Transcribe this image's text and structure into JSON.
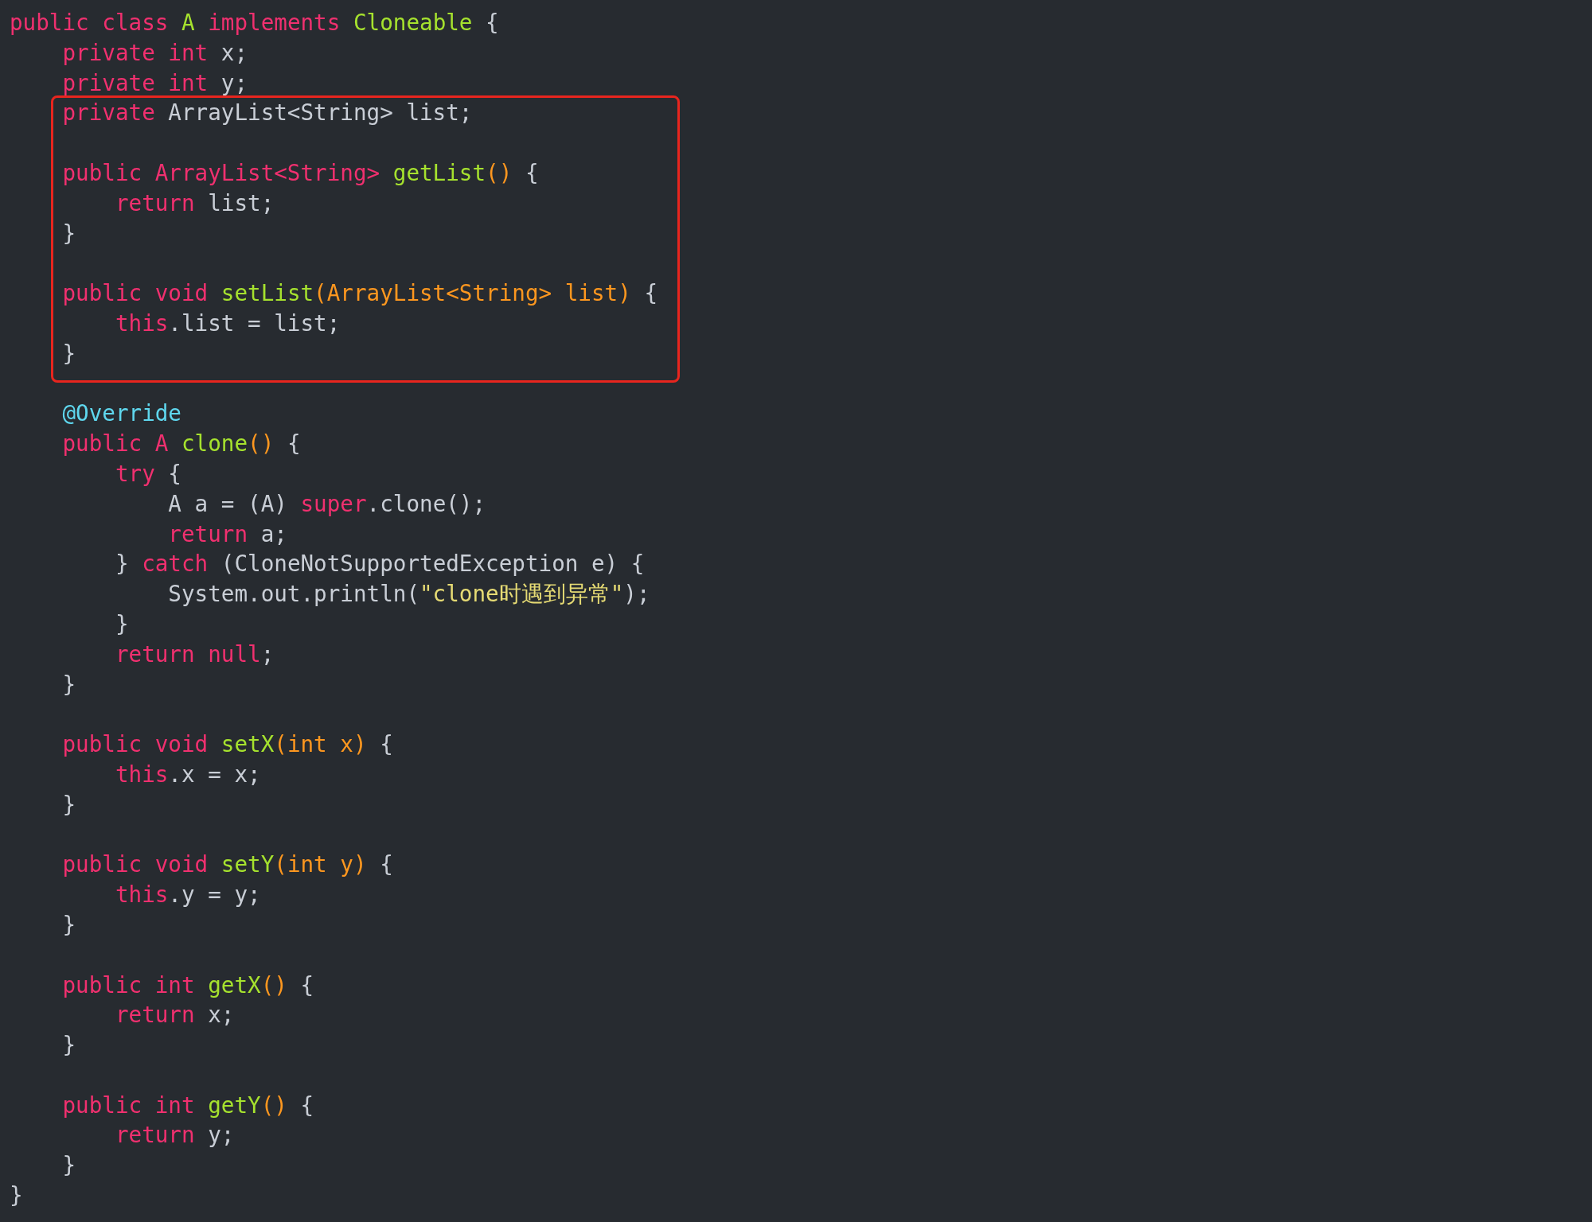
{
  "editor": {
    "segments": [
      {
        "highlighted": false,
        "lines": [
          {
            "kind": "code",
            "tokens": [
              {
                "text": "public class ",
                "kind": "kw"
              },
              {
                "text": "A",
                "kind": "fn"
              },
              {
                "text": " implements ",
                "kind": "kw"
              },
              {
                "text": "Cloneable",
                "kind": "fn"
              },
              {
                "text": " {",
                "kind": "pl"
              }
            ]
          },
          {
            "kind": "code",
            "tokens": [
              {
                "text": "    private int ",
                "kind": "kw"
              },
              {
                "text": "x;",
                "kind": "pl"
              }
            ]
          },
          {
            "kind": "code",
            "tokens": [
              {
                "text": "    private int ",
                "kind": "kw"
              },
              {
                "text": "y;",
                "kind": "pl"
              }
            ]
          }
        ]
      },
      {
        "highlighted": true,
        "lines": [
          {
            "kind": "code",
            "tokens": [
              {
                "text": "    private ",
                "kind": "kw"
              },
              {
                "text": "ArrayList<String> list;",
                "kind": "pl"
              }
            ]
          },
          {
            "kind": "blank"
          },
          {
            "kind": "code",
            "tokens": [
              {
                "text": "    public ArrayList<String> ",
                "kind": "kw"
              },
              {
                "text": "getList",
                "kind": "fn"
              },
              {
                "text": "()",
                "kind": "pa"
              },
              {
                "text": " {",
                "kind": "pl"
              }
            ]
          },
          {
            "kind": "code",
            "tokens": [
              {
                "text": "        return ",
                "kind": "kw"
              },
              {
                "text": "list;",
                "kind": "pl"
              }
            ]
          },
          {
            "kind": "code",
            "tokens": [
              {
                "text": "    }",
                "kind": "pl"
              }
            ]
          },
          {
            "kind": "blank"
          },
          {
            "kind": "code",
            "tokens": [
              {
                "text": "    public void ",
                "kind": "kw"
              },
              {
                "text": "setList",
                "kind": "fn"
              },
              {
                "text": "(ArrayList<String> list)",
                "kind": "pa"
              },
              {
                "text": " {",
                "kind": "pl"
              }
            ]
          },
          {
            "kind": "code",
            "tokens": [
              {
                "text": "        this",
                "kind": "kw"
              },
              {
                "text": ".list = list;",
                "kind": "pl"
              }
            ]
          },
          {
            "kind": "code",
            "tokens": [
              {
                "text": "    }",
                "kind": "pl"
              }
            ]
          }
        ]
      },
      {
        "highlighted": false,
        "lines": [
          {
            "kind": "blank"
          },
          {
            "kind": "code",
            "tokens": [
              {
                "text": "    @Override",
                "kind": "an"
              }
            ]
          },
          {
            "kind": "code",
            "tokens": [
              {
                "text": "    public A ",
                "kind": "kw"
              },
              {
                "text": "clone",
                "kind": "fn"
              },
              {
                "text": "()",
                "kind": "pa"
              },
              {
                "text": " {",
                "kind": "pl"
              }
            ]
          },
          {
            "kind": "code",
            "tokens": [
              {
                "text": "        try",
                "kind": "kw"
              },
              {
                "text": " {",
                "kind": "pl"
              }
            ]
          },
          {
            "kind": "code",
            "tokens": [
              {
                "text": "            A a = (A) ",
                "kind": "pl"
              },
              {
                "text": "super",
                "kind": "kw"
              },
              {
                "text": ".clone();",
                "kind": "pl"
              }
            ]
          },
          {
            "kind": "code",
            "tokens": [
              {
                "text": "            return ",
                "kind": "kw"
              },
              {
                "text": "a;",
                "kind": "pl"
              }
            ]
          },
          {
            "kind": "code",
            "tokens": [
              {
                "text": "        } ",
                "kind": "pl"
              },
              {
                "text": "catch",
                "kind": "kw"
              },
              {
                "text": " (CloneNotSupportedException e) {",
                "kind": "pl"
              }
            ]
          },
          {
            "kind": "code",
            "tokens": [
              {
                "text": "            System.out.println(",
                "kind": "pl"
              },
              {
                "text": "\"clone时遇到异常\"",
                "kind": "st"
              },
              {
                "text": ");",
                "kind": "pl"
              }
            ]
          },
          {
            "kind": "code",
            "tokens": [
              {
                "text": "        }",
                "kind": "pl"
              }
            ]
          },
          {
            "kind": "code",
            "tokens": [
              {
                "text": "        return null",
                "kind": "kw"
              },
              {
                "text": ";",
                "kind": "pl"
              }
            ]
          },
          {
            "kind": "code",
            "tokens": [
              {
                "text": "    }",
                "kind": "pl"
              }
            ]
          },
          {
            "kind": "blank"
          },
          {
            "kind": "code",
            "tokens": [
              {
                "text": "    public void ",
                "kind": "kw"
              },
              {
                "text": "setX",
                "kind": "fn"
              },
              {
                "text": "(int x)",
                "kind": "pa"
              },
              {
                "text": " {",
                "kind": "pl"
              }
            ]
          },
          {
            "kind": "code",
            "tokens": [
              {
                "text": "        this",
                "kind": "kw"
              },
              {
                "text": ".x = x;",
                "kind": "pl"
              }
            ]
          },
          {
            "kind": "code",
            "tokens": [
              {
                "text": "    }",
                "kind": "pl"
              }
            ]
          },
          {
            "kind": "blank"
          },
          {
            "kind": "code",
            "tokens": [
              {
                "text": "    public void ",
                "kind": "kw"
              },
              {
                "text": "setY",
                "kind": "fn"
              },
              {
                "text": "(int y)",
                "kind": "pa"
              },
              {
                "text": " {",
                "kind": "pl"
              }
            ]
          },
          {
            "kind": "code",
            "tokens": [
              {
                "text": "        this",
                "kind": "kw"
              },
              {
                "text": ".y = y;",
                "kind": "pl"
              }
            ]
          },
          {
            "kind": "code",
            "tokens": [
              {
                "text": "    }",
                "kind": "pl"
              }
            ]
          },
          {
            "kind": "blank"
          },
          {
            "kind": "code",
            "tokens": [
              {
                "text": "    public int ",
                "kind": "kw"
              },
              {
                "text": "getX",
                "kind": "fn"
              },
              {
                "text": "()",
                "kind": "pa"
              },
              {
                "text": " {",
                "kind": "pl"
              }
            ]
          },
          {
            "kind": "code",
            "tokens": [
              {
                "text": "        return ",
                "kind": "kw"
              },
              {
                "text": "x;",
                "kind": "pl"
              }
            ]
          },
          {
            "kind": "code",
            "tokens": [
              {
                "text": "    }",
                "kind": "pl"
              }
            ]
          },
          {
            "kind": "blank"
          },
          {
            "kind": "code",
            "tokens": [
              {
                "text": "    public int ",
                "kind": "kw"
              },
              {
                "text": "getY",
                "kind": "fn"
              },
              {
                "text": "()",
                "kind": "pa"
              },
              {
                "text": " {",
                "kind": "pl"
              }
            ]
          },
          {
            "kind": "code",
            "tokens": [
              {
                "text": "        return ",
                "kind": "kw"
              },
              {
                "text": "y;",
                "kind": "pl"
              }
            ]
          },
          {
            "kind": "code",
            "tokens": [
              {
                "text": "    }",
                "kind": "pl"
              }
            ]
          },
          {
            "kind": "code",
            "tokens": [
              {
                "text": "}",
                "kind": "pl"
              }
            ]
          }
        ]
      }
    ]
  }
}
